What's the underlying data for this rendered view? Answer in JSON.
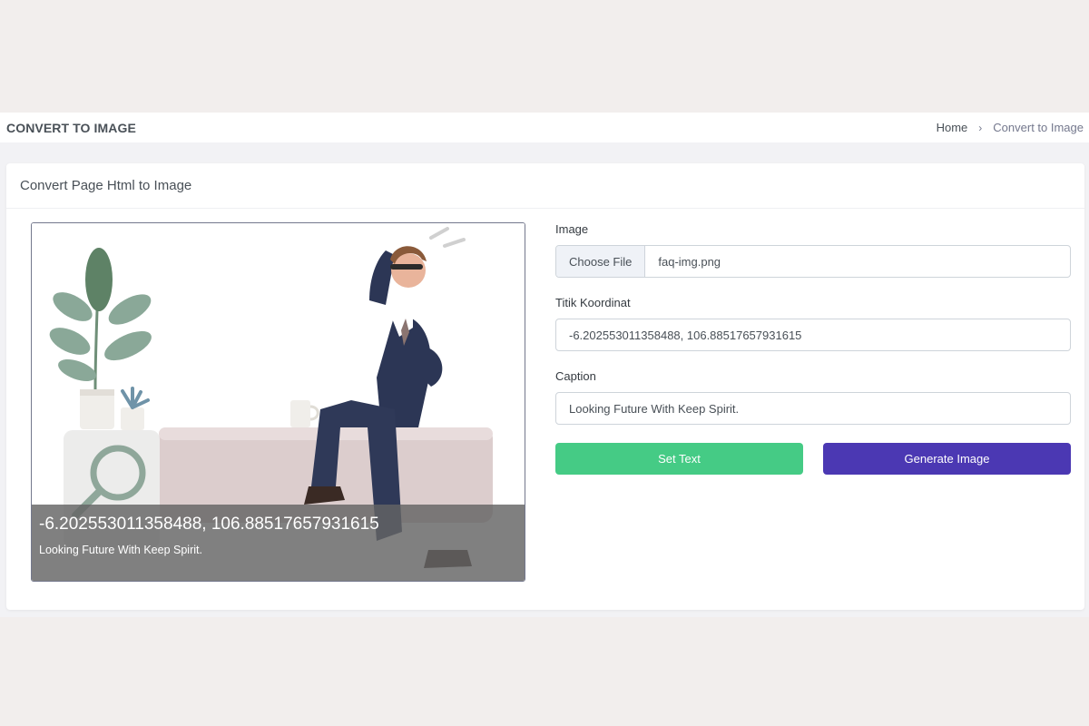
{
  "header": {
    "title": "CONVERT TO IMAGE",
    "breadcrumb": {
      "home": "Home",
      "separator": "›",
      "current": "Convert to Image"
    }
  },
  "card": {
    "title": "Convert Page Html to Image"
  },
  "preview": {
    "coordinate_text": "-6.202553011358488, 106.88517657931615",
    "caption_text": "Looking Future With Keep Spirit."
  },
  "form": {
    "image_label": "Image",
    "choose_file_label": "Choose File",
    "file_name": "faq-img.png",
    "coordinate_label": "Titik Koordinat",
    "coordinate_value": "-6.202553011358488, 106.88517657931615",
    "caption_label": "Caption",
    "caption_value": "Looking Future With Keep Spirit.",
    "set_text_button": "Set Text",
    "generate_button": "Generate Image"
  },
  "colors": {
    "success": "#45cb85",
    "primary": "#4b38b3",
    "overlay": "#646464"
  }
}
